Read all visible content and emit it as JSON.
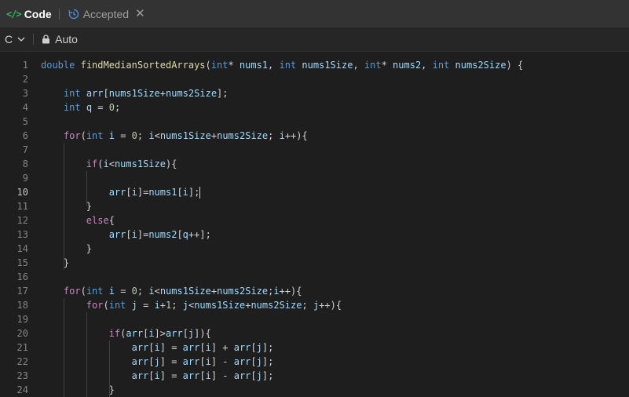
{
  "tabs": {
    "code_icon": "</>",
    "code_label": "Code",
    "accepted_label": "Accepted",
    "close_glyph": "✕"
  },
  "toolbar": {
    "language": "C",
    "mode": "Auto"
  },
  "editor": {
    "active_line": 10,
    "line_numbers": [
      "1",
      "2",
      "3",
      "4",
      "5",
      "6",
      "7",
      "8",
      "9",
      "10",
      "11",
      "12",
      "13",
      "14",
      "15",
      "16",
      "17",
      "18",
      "19",
      "20",
      "21",
      "22",
      "23",
      "24"
    ],
    "lines": [
      "double findMedianSortedArrays(int* nums1, int nums1Size, int* nums2, int nums2Size) {",
      "",
      "    int arr[nums1Size+nums2Size];",
      "    int q = 0;",
      "",
      "    for(int i = 0; i<nums1Size+nums2Size; i++){",
      "",
      "        if(i<nums1Size){",
      "",
      "            arr[i]=nums1[i];",
      "        }",
      "        else{",
      "            arr[i]=nums2[q++];",
      "        }",
      "    }",
      "",
      "    for(int i = 0; i<nums1Size+nums2Size;i++){",
      "        for(int j = i+1; j<nums1Size+nums2Size; j++){",
      "",
      "            if(arr[i]>arr[j]){",
      "                arr[i] = arr[i] + arr[j];",
      "                arr[j] = arr[i] - arr[j];",
      "                arr[i] = arr[i] - arr[j];",
      "            }"
    ]
  },
  "colors": {
    "keyword": "#569cd6",
    "control": "#c586c0",
    "function": "#dcdcaa",
    "variable": "#9cdcfe",
    "number": "#b5cea8",
    "accent_green": "#2cbb5d"
  }
}
